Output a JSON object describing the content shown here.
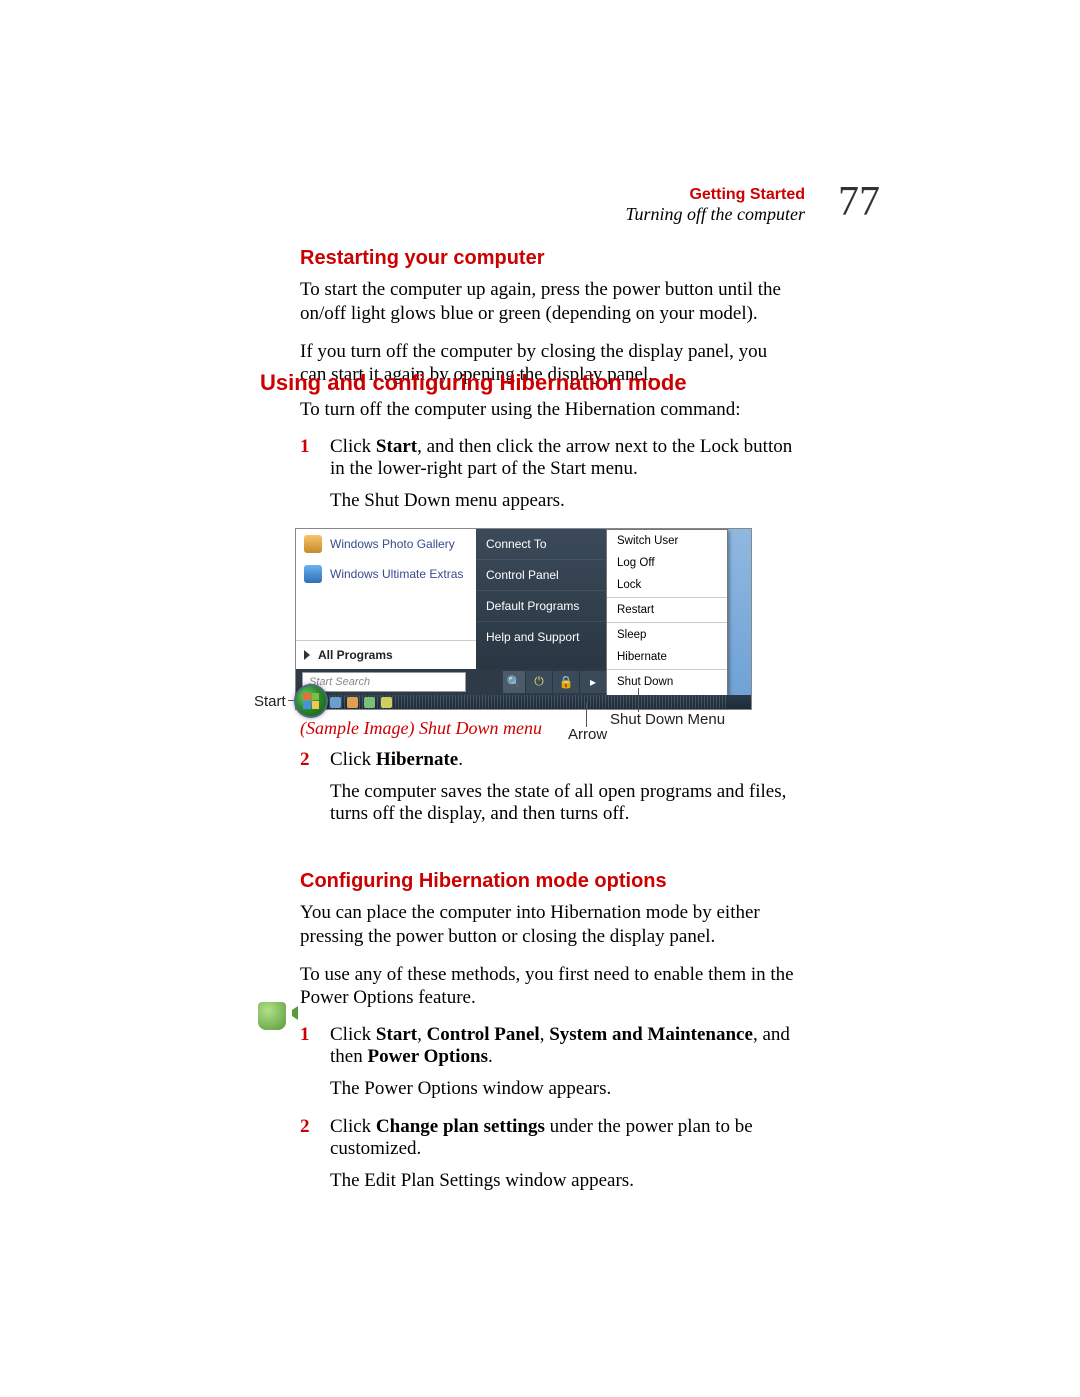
{
  "header": {
    "chapter": "Getting Started",
    "subtitle": "Turning off the computer",
    "page_number": "77"
  },
  "s1": {
    "heading": "Restarting your computer",
    "p1": "To start the computer up again, press the power button until the on/off light glows blue or green (depending on your model).",
    "p2": "If you turn off the computer by closing the display panel, you can start it again by opening the display panel."
  },
  "s2": {
    "heading": "Using and configuring Hibernation mode",
    "intro": "To turn off the computer using the Hibernation command:",
    "step1": {
      "num": "1",
      "t1a": "Click ",
      "t1b": "Start",
      "t1c": ", and then click the arrow next to the Lock button in the lower-right part of the Start menu.",
      "t2": "The Shut Down menu appears."
    },
    "caption": "(Sample Image) Shut Down menu",
    "step2": {
      "num": "2",
      "t1a": "Click ",
      "t1b": "Hibernate",
      "t1c": ".",
      "t2": "The computer saves the state of all open programs and files, turns off the display, and then turns off."
    }
  },
  "shot": {
    "left": {
      "photo_gallery": "Windows Photo Gallery",
      "ultimate_extras": "Windows Ultimate Extras",
      "all_programs": "All Programs"
    },
    "mid": {
      "connect_to": "Connect To",
      "control_panel": "Control Panel",
      "default_programs": "Default Programs",
      "help_support": "Help and Support"
    },
    "right": {
      "switch_user": "Switch User",
      "log_off": "Log Off",
      "lock": "Lock",
      "restart": "Restart",
      "sleep": "Sleep",
      "hibernate": "Hibernate",
      "shut_down": "Shut Down"
    },
    "search_placeholder": "Start Search",
    "callouts": {
      "start": "Start",
      "arrow": "Arrow",
      "menu": "Shut Down Menu"
    }
  },
  "s3": {
    "heading": "Configuring Hibernation mode options",
    "p1": "You can place the computer into Hibernation mode by either pressing the power button or closing the display panel.",
    "p2": "To use any of these methods, you first need to enable them in the Power Options feature.",
    "step1": {
      "num": "1",
      "a": "Click ",
      "b": "Start",
      "c": ", ",
      "d": "Control Panel",
      "e": ", ",
      "f": "System and Maintenance",
      "g": ", and then ",
      "h": "Power Options",
      "i": ".",
      "t2": "The Power Options window appears."
    },
    "step2": {
      "num": "2",
      "a": "Click ",
      "b": "Change plan settings",
      "c": " under the power plan to be customized.",
      "t2": "The Edit Plan Settings window appears."
    }
  }
}
